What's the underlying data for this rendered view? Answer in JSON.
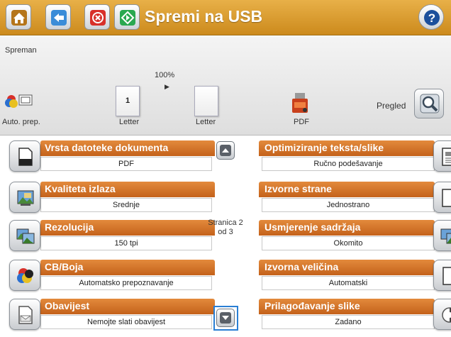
{
  "header": {
    "title": "Spremi na USB",
    "home_icon": "home-icon",
    "back_icon": "back-icon",
    "stop_icon": "stop-icon",
    "start_icon": "start-icon",
    "help_icon": "help-icon",
    "accent_color": "#d99a2e"
  },
  "status": {
    "text": "Spreman"
  },
  "preview": {
    "zoom": "100%",
    "auto_prep_label": "Auto. prep.",
    "page_number": "1",
    "page1_label": "Letter",
    "page2_label": "Letter",
    "format_label": "PDF",
    "preview_label": "Pregled"
  },
  "settings": {
    "left": [
      {
        "label": "Vrsta datoteke dokumenta",
        "value": "PDF"
      },
      {
        "label": "Kvaliteta izlaza",
        "value": "Srednje"
      },
      {
        "label": "Rezolucija",
        "value": "150 tpi"
      },
      {
        "label": "CB/Boja",
        "value": "Automatsko prepoznavanje"
      },
      {
        "label": "Obavijest",
        "value": "Nemojte slati obavijest"
      }
    ],
    "right": [
      {
        "label": "Optimiziranje teksta/slike",
        "value": "Ručno podešavanje"
      },
      {
        "label": "Izvorne strane",
        "value": "Jednostrano"
      },
      {
        "label": "Usmjerenje sadržaja",
        "value": "Okomito"
      },
      {
        "label": "Izvorna veličina",
        "value": "Automatski"
      },
      {
        "label": "Prilagođavanje slike",
        "value": "Zadano"
      }
    ]
  },
  "pagination": {
    "line1": "Stranica 2",
    "line2": "od 3"
  },
  "colors": {
    "setting_header": "#d8742a",
    "highlight_border": "#2a7fd4"
  }
}
